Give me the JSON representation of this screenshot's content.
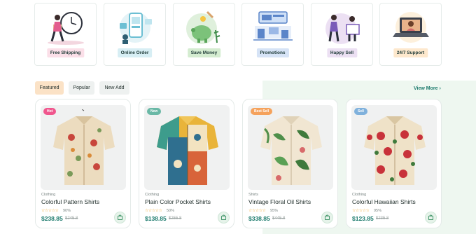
{
  "features": [
    {
      "label": "Free Shipping",
      "icon": "delivery-clock-illustration",
      "tag_color": "#fbdfe8"
    },
    {
      "label": "Online Order",
      "icon": "online-order-illustration",
      "tag_color": "#d7eef4"
    },
    {
      "label": "Save Money",
      "icon": "piggy-bank-illustration",
      "tag_color": "#d4ecd0"
    },
    {
      "label": "Promotions",
      "icon": "promotions-billboard-illustration",
      "tag_color": "#d6e3f6"
    },
    {
      "label": "Happy Sell",
      "icon": "happy-sell-illustration",
      "tag_color": "#ece0f3"
    },
    {
      "label": "24/7 Support",
      "icon": "laptop-support-illustration",
      "tag_color": "#fde8cd"
    }
  ],
  "tabs": [
    {
      "label": "Featured",
      "active": true
    },
    {
      "label": "Popular",
      "active": false
    },
    {
      "label": "New Add",
      "active": false
    }
  ],
  "view_more": "View More",
  "products": [
    {
      "badge": "Hot",
      "badge_color": "#f0568d",
      "category": "Clothing",
      "name": "Colorful Pattern Shirts",
      "rating": "90%",
      "price": "$238.85",
      "old_price": "$245.8",
      "shirt": "beige-mushroom-print-shirt"
    },
    {
      "badge": "New",
      "badge_color": "#6ab8a6",
      "category": "Clothing",
      "name": "Plain Color Pocket Shirts",
      "rating": "50%",
      "price": "$138.85",
      "old_price": "$255.8",
      "shirt": "yellow-blue-patchwork-shirt"
    },
    {
      "badge": "Best Sell",
      "badge_color": "#f5a25c",
      "category": "Shirts",
      "name": "Vintage Floral Oil Shirts",
      "rating": "95%",
      "price": "$338.85",
      "old_price": "$445.8",
      "shirt": "cream-palm-leaf-shirt"
    },
    {
      "badge": "Sell",
      "badge_color": "#7fb1dc",
      "category": "Clothing",
      "name": "Colorful Hawaiian Shirts",
      "rating": "95%",
      "price": "$123.85",
      "old_price": "$235.8",
      "shirt": "red-floral-hawaiian-shirt"
    }
  ],
  "colors": {
    "accent": "#1b7a6c",
    "star": "#f2a324"
  }
}
